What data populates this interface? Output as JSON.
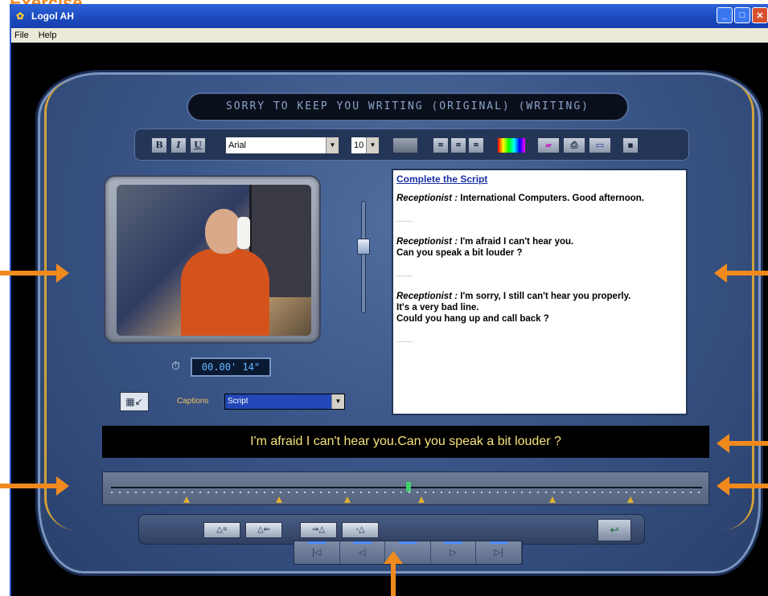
{
  "annotation": {
    "top_label": "Exercise"
  },
  "window": {
    "title": "Logol AH",
    "menu": [
      "File",
      "Help"
    ],
    "controls": {
      "minimize": "_",
      "maximize": "□",
      "close": "✕"
    }
  },
  "player": {
    "title_display": "SORRY TO KEEP YOU WRITING (ORIGINAL) (WRITING)",
    "toolbar": {
      "bold": "B",
      "italic": "I",
      "underline": "U",
      "font": "Arial",
      "size": "10",
      "icons": [
        "color-swatch-icon",
        "align-left-icon",
        "align-center-icon",
        "align-right-icon",
        "palette-icon",
        "eraser-icon",
        "print-icon",
        "open-folder-icon",
        "save-icon"
      ]
    },
    "timer": "00.00' 14\"",
    "captions_label": "Captions",
    "captions_value": "Script"
  },
  "script": {
    "title": "Complete the Script",
    "entries": [
      {
        "speaker": "Receptionist :",
        "lines": [
          "International Computers. Good afternoon."
        ]
      },
      {
        "speaker": "Receptionist :",
        "lines": [
          "I'm afraid I can't hear you.",
          "Can you speak a bit louder ?"
        ]
      },
      {
        "speaker": "Receptionist :",
        "lines": [
          "I'm sorry, I still can't hear you properly.",
          "It's a very bad line.",
          "Could you hang up and call back ?"
        ]
      }
    ],
    "blank": "........."
  },
  "caption": "I'm afraid I can't hear you.Can you speak a bit louder ?",
  "controls": {
    "buttons": [
      "△=",
      "△⇐",
      "⇒△",
      "◦△"
    ],
    "transport": [
      "|◁",
      "◁",
      "",
      "▷",
      "▷|"
    ]
  }
}
